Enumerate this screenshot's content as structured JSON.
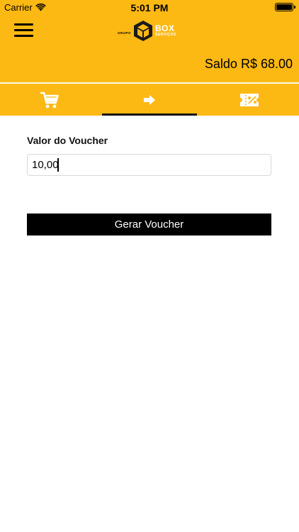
{
  "status_bar": {
    "carrier": "Carrier",
    "time": "5:01 PM"
  },
  "header": {
    "logo": {
      "grupo": "GRUPO",
      "box": "BOX",
      "servicos": "SERVIÇOS"
    },
    "saldo": "Saldo R$ 68.00"
  },
  "tabs": [
    {
      "icon": "cart-icon",
      "active": false
    },
    {
      "icon": "arrow-right-icon",
      "active": true
    },
    {
      "icon": "voucher-percent-icon",
      "active": false
    }
  ],
  "form": {
    "label": "Valor do Voucher",
    "value": "10,00",
    "button": "Gerar Voucher"
  },
  "colors": {
    "accent": "#FDB913",
    "button": "#000000"
  }
}
